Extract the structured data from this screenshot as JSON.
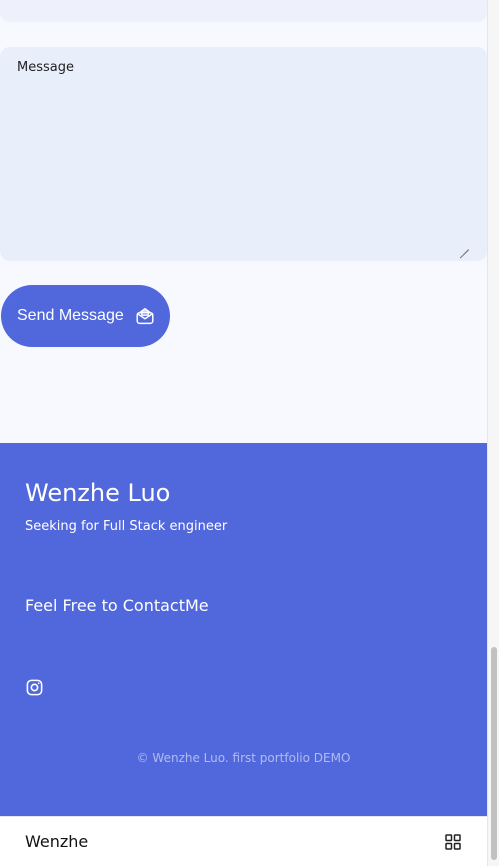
{
  "form": {
    "message_label": "Message",
    "send_label": "Send Message"
  },
  "footer": {
    "name": "Wenzhe Luo",
    "tagline": "Seeking for Full Stack engineer",
    "contact": "Feel Free to ContactMe",
    "social_icon": "instagram-icon",
    "copyright": "© Wenzhe Luo. first portfolio DEMO"
  },
  "bottom_nav": {
    "brand": "Wenzhe",
    "menu_icon": "grid-menu-icon"
  },
  "colors": {
    "accent": "#5167dc",
    "page_bg": "#f8f9ff",
    "input_bg": "#e9eefb"
  }
}
